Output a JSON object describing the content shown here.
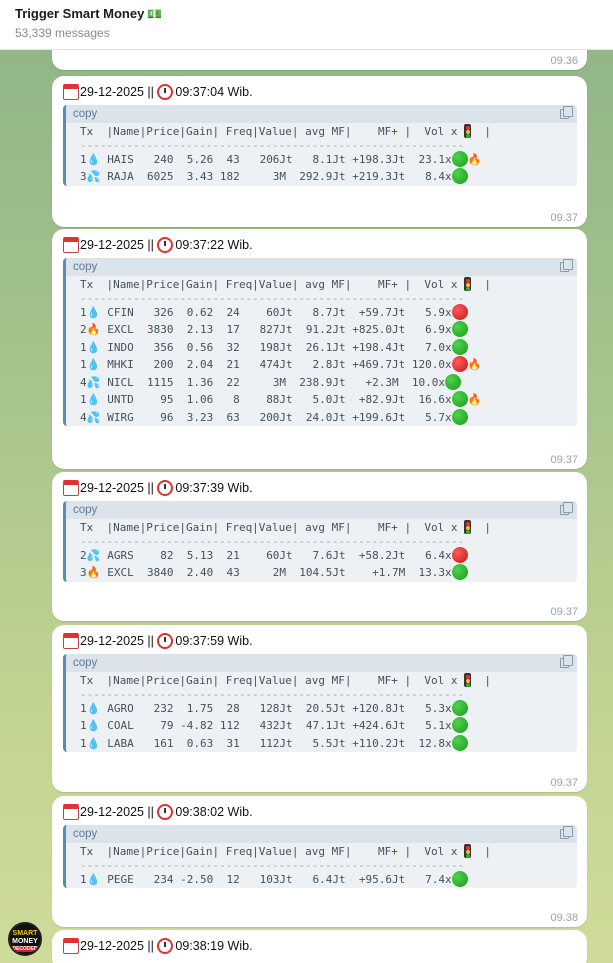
{
  "header": {
    "title": "Trigger Smart Money",
    "subtitle": "53,339 messages"
  },
  "avatar": {
    "line1": "SMART",
    "line2": "MONEY",
    "line3": "DECODED"
  },
  "messages": {
    "m0": {
      "time": "09.36"
    },
    "m1": {
      "date": "29-12-2025",
      "sep": " || ",
      "clock": "09:37:04 Wib.",
      "code_label": "copy",
      "header_row": "Tx  |Name|Price|Gain| Freq|Value| avg MF|    MF+ |  Vol x",
      "header_tail": "  |",
      "dash_row": "----------------------------------------------------------",
      "rows": {
        "r0": {
          "tx": "1",
          "icon": "drop",
          "text": " HAIS   240  5.26  43   206Jt   8.1Jt +198.3Jt  23.1x",
          "signal": "green",
          "extra": "fire"
        },
        "r1": {
          "tx": "3",
          "icon": "drops",
          "text": " RAJA  6025  3.43 182     3M  292.9Jt +219.3Jt   8.4x",
          "signal": "green",
          "extra": ""
        }
      },
      "time": "09.37"
    },
    "m2": {
      "date": "29-12-2025",
      "sep": " || ",
      "clock": "09:37:22 Wib.",
      "code_label": "copy",
      "header_row": "Tx  |Name|Price|Gain| Freq|Value| avg MF|    MF+ |  Vol x",
      "header_tail": "  |",
      "dash_row": "----------------------------------------------------------",
      "rows": {
        "r0": {
          "tx": "1",
          "icon": "drop",
          "text": " CFIN   326  0.62  24    60Jt   8.7Jt  +59.7Jt   5.9x",
          "signal": "red",
          "extra": ""
        },
        "r1": {
          "tx": "2",
          "icon": "fire",
          "text": " EXCL  3830  2.13  17   827Jt  91.2Jt +825.0Jt   6.9x",
          "signal": "green",
          "extra": ""
        },
        "r2": {
          "tx": "1",
          "icon": "drop",
          "text": " INDO   356  0.56  32   198Jt  26.1Jt +198.4Jt   7.0x",
          "signal": "green",
          "extra": ""
        },
        "r3": {
          "tx": "1",
          "icon": "drop",
          "text": " MHKI   200  2.04  21   474Jt   2.8Jt +469.7Jt 120.0x",
          "signal": "red",
          "extra": "fire"
        },
        "r4": {
          "tx": "4",
          "icon": "drops",
          "text": " NICL  1115  1.36  22     3M  238.9Jt   +2.3M  10.0x",
          "signal": "green",
          "extra": ""
        },
        "r5": {
          "tx": "1",
          "icon": "drop",
          "text": " UNTD    95  1.06   8    88Jt   5.0Jt  +82.9Jt  16.6x",
          "signal": "green",
          "extra": "fire"
        },
        "r6": {
          "tx": "4",
          "icon": "drops",
          "text": " WIRG    96  3.23  63   200Jt  24.0Jt +199.6Jt   5.7x",
          "signal": "green",
          "extra": ""
        }
      },
      "time": "09.37"
    },
    "m3": {
      "date": "29-12-2025",
      "sep": " || ",
      "clock": "09:37:39 Wib.",
      "code_label": "copy",
      "header_row": "Tx  |Name|Price|Gain| Freq|Value| avg MF|    MF+ |  Vol x",
      "header_tail": "  |",
      "dash_row": "----------------------------------------------------------",
      "rows": {
        "r0": {
          "tx": "2",
          "icon": "drops",
          "text": " AGRS    82  5.13  21    60Jt   7.6Jt  +58.2Jt   6.4x",
          "signal": "red",
          "extra": ""
        },
        "r1": {
          "tx": "3",
          "icon": "fire",
          "text": " EXCL  3840  2.40  43     2M  104.5Jt    +1.7M  13.3x",
          "signal": "green",
          "extra": ""
        }
      },
      "time": "09.37"
    },
    "m4": {
      "date": "29-12-2025",
      "sep": " || ",
      "clock": "09:37:59 Wib.",
      "code_label": "copy",
      "header_row": "Tx  |Name|Price|Gain| Freq|Value| avg MF|    MF+ |  Vol x",
      "header_tail": "  |",
      "dash_row": "----------------------------------------------------------",
      "rows": {
        "r0": {
          "tx": "1",
          "icon": "drop",
          "text": " AGRO   232  1.75  28   128Jt  20.5Jt +120.8Jt   5.3x",
          "signal": "green",
          "extra": ""
        },
        "r1": {
          "tx": "1",
          "icon": "drop",
          "text": " COAL    79 -4.82 112   432Jt  47.1Jt +424.6Jt   5.1x",
          "signal": "green",
          "extra": ""
        },
        "r2": {
          "tx": "1",
          "icon": "drop",
          "text": " LABA   161  0.63  31   112Jt   5.5Jt +110.2Jt  12.8x",
          "signal": "green",
          "extra": ""
        }
      },
      "time": "09.37"
    },
    "m5": {
      "date": "29-12-2025",
      "sep": " || ",
      "clock": "09:38:02 Wib.",
      "code_label": "copy",
      "header_row": "Tx  |Name|Price|Gain| Freq|Value| avg MF|    MF+ |  Vol x",
      "header_tail": "  |",
      "dash_row": "----------------------------------------------------------",
      "rows": {
        "r0": {
          "tx": "1",
          "icon": "drop",
          "text": " PEGE   234 -2.50  12   103Jt   6.4Jt  +95.6Jt   7.4x",
          "signal": "green",
          "extra": ""
        }
      },
      "time": "09.38"
    },
    "m6": {
      "date": "29-12-2025",
      "sep": " || ",
      "clock": "09:38:19 Wib."
    }
  }
}
